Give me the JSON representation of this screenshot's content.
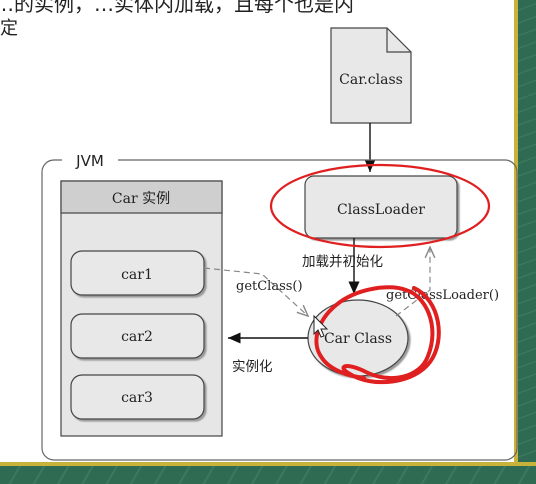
{
  "top_text": {
    "line1": "…的实例，…实体内加载，且每个也是内",
    "line2": "定"
  },
  "diagram": {
    "file_label": "Car.class",
    "jvm_label": "JVM",
    "instances_header": "Car 实例",
    "instances": [
      "car1",
      "car2",
      "car3"
    ],
    "classloader_label": "ClassLoader",
    "car_class_label": "Car Class",
    "edge_load_init": "加载并初始化",
    "edge_getclass": "getClass()",
    "edge_getclassloader": "getClassLoader()",
    "edge_instantiate": "实例化"
  },
  "colors": {
    "frame_green": "#2f6b52",
    "frame_gold": "#c9b23a",
    "annotation_red": "#e02020",
    "box_fill": "#e8e8e8",
    "header_fill": "#d0d0d0"
  }
}
